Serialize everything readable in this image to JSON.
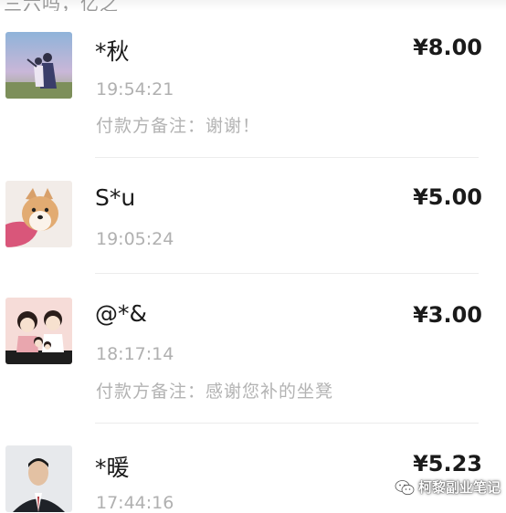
{
  "top_fragment": "三六吗，亿之",
  "payments": [
    {
      "name": "*秋",
      "amount": "¥8.00",
      "time": "19:54:21",
      "remark": "付款方备注：谢谢！"
    },
    {
      "name": "S*u",
      "amount": "¥5.00",
      "time": "19:05:24"
    },
    {
      "name": "@*&",
      "amount": "¥3.00",
      "time": "18:17:14",
      "remark": "付款方备注：感谢您补的坐凳"
    },
    {
      "name": "*暖",
      "amount": "¥5.23",
      "time": "17:44:16"
    }
  ],
  "watermark": {
    "text": "柯黎副业笔记",
    "icon": "wechat-icon"
  }
}
